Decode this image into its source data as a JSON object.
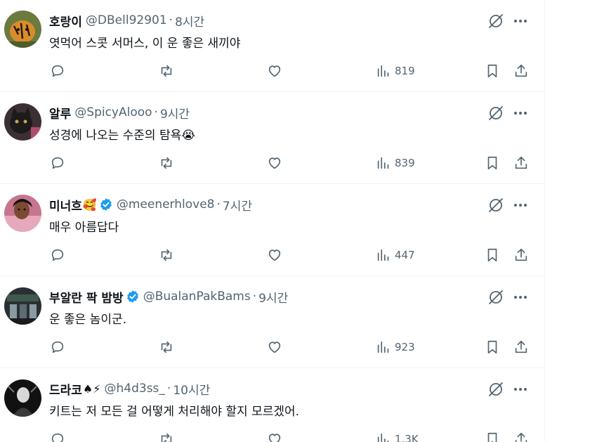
{
  "tweets": [
    {
      "name": "호랑이",
      "emoji": "",
      "verified": false,
      "handle": "@DBell92901",
      "separator": "·",
      "time": "8시간",
      "text": "엿먹어 스콧 서머스, 이 운 좋은 새끼야",
      "views": "819",
      "avatar_icon": "tiger-avatar"
    },
    {
      "name": "알루",
      "emoji": "",
      "verified": false,
      "handle": "@SpicyAlooo",
      "separator": "·",
      "time": "9시간",
      "text": "성경에 나오는 수준의 탐욕😭",
      "views": "839",
      "avatar_icon": "cat-avatar"
    },
    {
      "name": "미너흐",
      "emoji": "🥰",
      "verified": true,
      "handle": "@meenerhlove8",
      "separator": "·",
      "time": "7시간",
      "text": "매우 아름답다",
      "views": "447",
      "avatar_icon": "person-avatar"
    },
    {
      "name": "부알란 팍 밤방",
      "emoji": "",
      "verified": true,
      "handle": "@BualanPakBams",
      "separator": "·",
      "time": "9시간",
      "text": "운 좋은 놈이군.",
      "views": "923",
      "avatar_icon": "storefront-avatar"
    },
    {
      "name": "드라코",
      "emoji": "♠⚡",
      "verified": false,
      "handle": "@h4d3ss_",
      "separator": "·",
      "time": "10시간",
      "text": "키트는 저 모든 걸 어떻게 처리해야 할지 모르겠어.",
      "views": "1.3K",
      "avatar_icon": "dark-figure-avatar"
    }
  ],
  "colors": {
    "text_primary": "#0f1419",
    "text_secondary": "#536471",
    "verified_blue": "#1d9bf0",
    "divider": "#eff3f4"
  },
  "icons": {
    "reply": "reply-icon",
    "repost": "repost-icon",
    "like": "like-icon",
    "views": "views-icon",
    "bookmark": "bookmark-icon",
    "share": "share-icon",
    "grok": "grok-icon",
    "more": "more-icon",
    "verified": "verified-badge-icon"
  }
}
